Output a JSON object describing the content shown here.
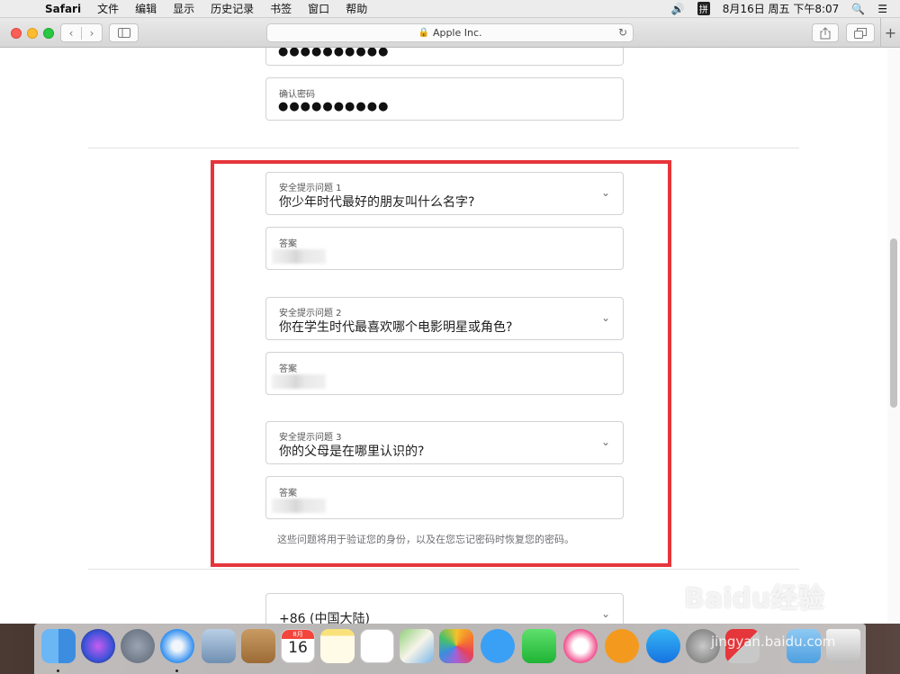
{
  "menubar": {
    "app_name": "Safari",
    "items": [
      "文件",
      "编辑",
      "显示",
      "历史记录",
      "书签",
      "窗口",
      "帮助"
    ],
    "input_method": "拼",
    "clock": "8月16日 周五 下午8:07"
  },
  "browser": {
    "address": "Apple Inc."
  },
  "form": {
    "password_dots": "●●●●●●●●●●",
    "confirm_label": "确认密码",
    "confirm_dots": "●●●●●●●●●●",
    "questions": [
      {
        "label": "安全提示问题 1",
        "value": "你少年时代最好的朋友叫什么名字?",
        "answer_label": "答案"
      },
      {
        "label": "安全提示问题 2",
        "value": "你在学生时代最喜欢哪个电影明星或角色?",
        "answer_label": "答案"
      },
      {
        "label": "安全提示问题 3",
        "value": "你的父母是在哪里认识的?",
        "answer_label": "答案"
      }
    ],
    "hint": "这些问题将用于验证您的身份，以及在您忘记密码时恢复您的密码。",
    "country": "+86 (中国大陆)"
  },
  "dock": {
    "calendar_month": "8月",
    "calendar_day": "16",
    "icons": [
      "finder-icon",
      "siri-icon",
      "launchpad-icon",
      "safari-icon",
      "preview-icon",
      "contacts-icon",
      "calendar-icon",
      "notes-icon",
      "reminders-icon",
      "maps-icon",
      "photos-icon",
      "messages-icon",
      "facetime-icon",
      "music-icon",
      "books-icon",
      "app-store-icon",
      "system-preferences-icon",
      "parallels-icon",
      "downloads-folder-icon",
      "trash-icon"
    ]
  },
  "watermark": {
    "logo": "Baidu经验",
    "url": "jingyan.baidu.com"
  },
  "colors": {
    "highlight": "#e5353b",
    "traffic_red": "#fc5f57",
    "traffic_yellow": "#fdbc2e",
    "traffic_green": "#28c840"
  }
}
